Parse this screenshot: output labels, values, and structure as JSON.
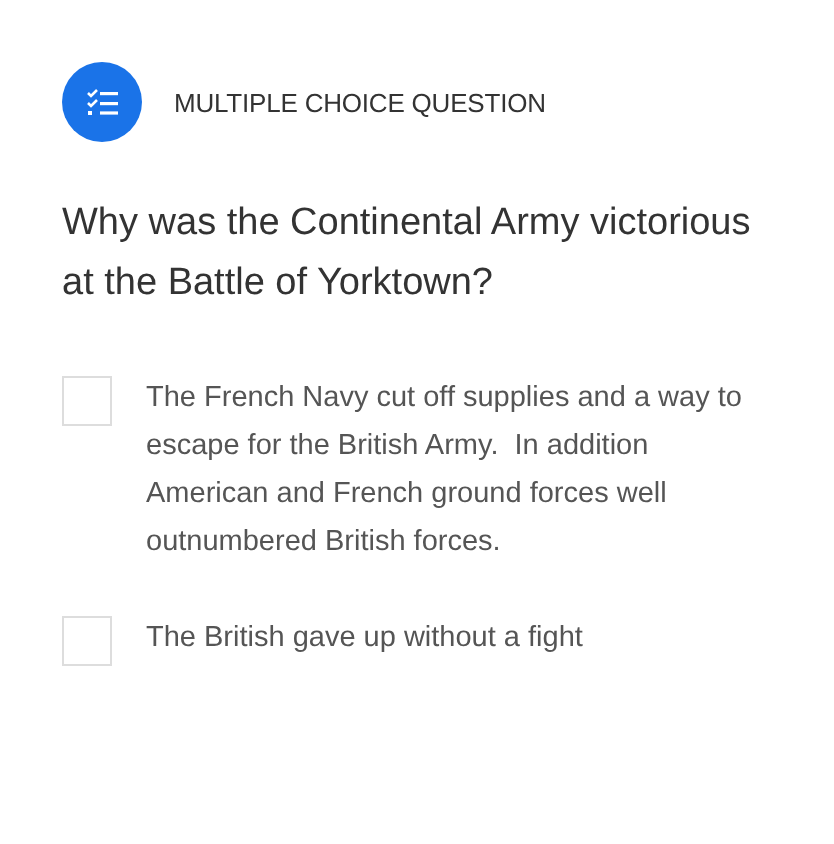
{
  "header": {
    "label": "MULTIPLE CHOICE QUESTION"
  },
  "question": "Why was the Continental Army victorious at the Battle of Yorktown?",
  "options": [
    {
      "text": "The French Navy cut off supplies and a way to escape for the British Army.  In addition American and French ground forces well outnumbered British forces.",
      "checked": false
    },
    {
      "text": "The British gave up without a fight",
      "checked": false
    }
  ]
}
